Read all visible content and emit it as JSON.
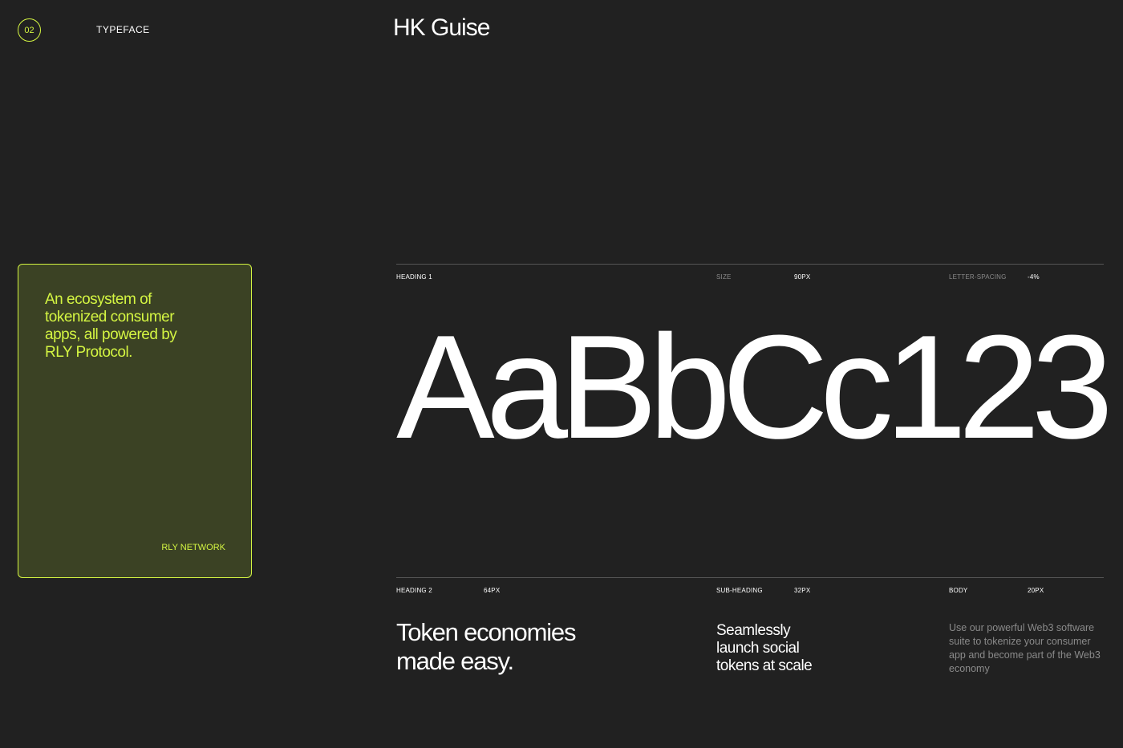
{
  "header": {
    "badge_number": "02",
    "section_label": "TYPEFACE",
    "font_name": "HK Guise"
  },
  "card": {
    "text": "An ecosystem of tokenized consumer apps, all powered by RLY Protocol.",
    "footer": "RLY NETWORK"
  },
  "heading1": {
    "label": "HEADING 1",
    "size_label": "SIZE",
    "size_value": "90PX",
    "spacing_label": "LETTER-SPACING",
    "spacing_value": "-4%",
    "specimen": "AaBbCc123"
  },
  "styles": {
    "heading2_label": "HEADING 2",
    "heading2_size": "64PX",
    "heading2_sample": "Token economies made easy.",
    "subheading_label": "SUB-HEADING",
    "subheading_size": "32PX",
    "subheading_sample": "Seamlessly launch social tokens at scale",
    "body_label": "BODY",
    "body_size": "20PX",
    "body_sample": "Use our powerful Web3 software suite to tokenize your consumer app and become part of the Web3 economy"
  },
  "colors": {
    "background": "#212121",
    "accent": "#d4f542",
    "card_fill": "#3b4224",
    "text": "#ffffff",
    "muted": "#8a8a8a"
  }
}
